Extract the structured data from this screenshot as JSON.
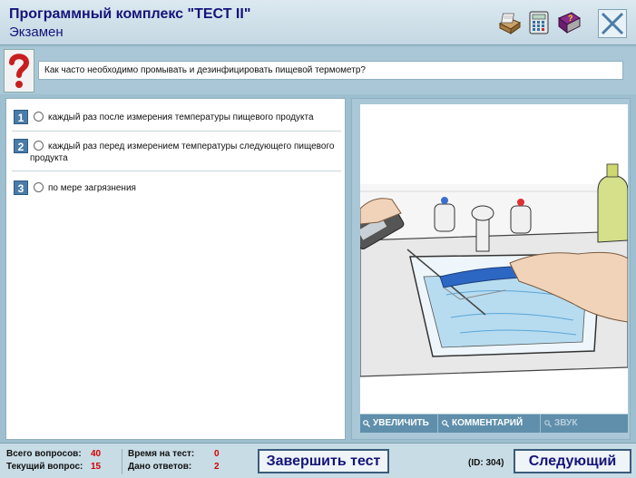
{
  "header": {
    "title": "Программный комплекс \"ТЕСТ II\"",
    "subtitle": "Экзамен"
  },
  "question": {
    "text": "Как часто необходимо промывать и дезинфицировать пищевой термометр?"
  },
  "answers": [
    {
      "num": "1",
      "text": "каждый раз после измерения температуры пищевого продукта"
    },
    {
      "num": "2",
      "text": "каждый раз перед измерением температуры следующего пищевого продукта"
    },
    {
      "num": "3",
      "text": "по мере загрязнения"
    }
  ],
  "image_toolbar": {
    "zoom": "УВЕЛИЧИТЬ",
    "comment": "КОММЕНТАРИЙ",
    "sound": "ЗВУК"
  },
  "footer": {
    "total_label": "Всего вопросов:",
    "total_value": "40",
    "current_label": "Текущий вопрос:",
    "current_value": "15",
    "time_label": "Время на тест:",
    "time_value": "0",
    "answered_label": "Дано ответов:",
    "answered_value": "2",
    "finish_button": "Завершить тест",
    "id_text": "(ID: 304)",
    "next_button": "Следующий"
  },
  "colors": {
    "accent": "#14147a",
    "background": "#9ebfcf",
    "stat_value": "#d40000"
  },
  "icons": [
    "card-file-icon",
    "calculator-icon",
    "help-book-icon",
    "close-icon",
    "question-mark-icon"
  ]
}
